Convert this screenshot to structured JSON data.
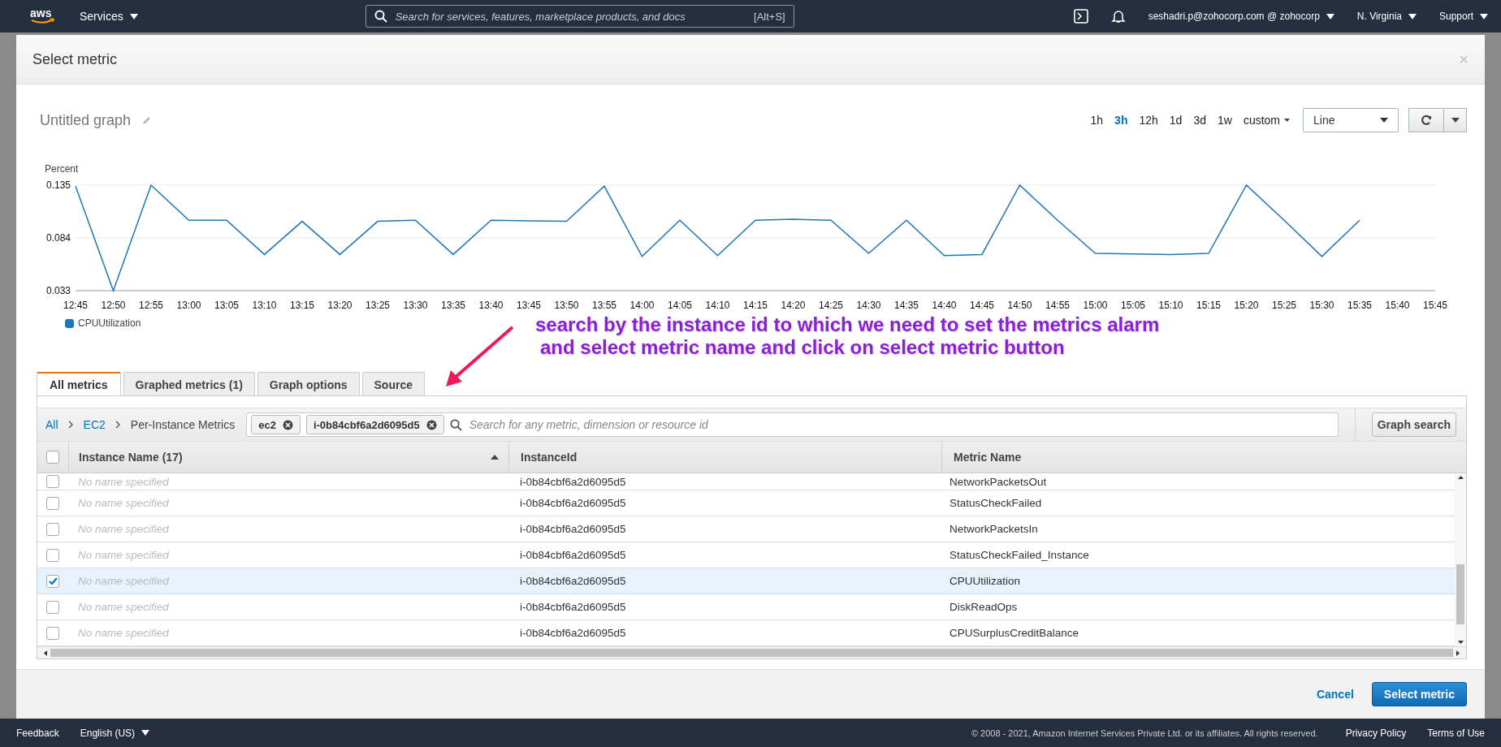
{
  "top_nav": {
    "logo": "aws",
    "services": "Services",
    "search": {
      "placeholder": "Search for services, features, marketplace products, and docs",
      "shortcut": "[Alt+S]"
    },
    "account": "seshadri.p@zohocorp.com @ zohocorp",
    "region": "N. Virginia",
    "support": "Support"
  },
  "dialog": {
    "title": "Select metric",
    "close": "×"
  },
  "graph": {
    "title": "Untitled graph",
    "ranges": [
      {
        "label": "1h",
        "selected": false
      },
      {
        "label": "3h",
        "selected": true
      },
      {
        "label": "12h",
        "selected": false
      },
      {
        "label": "1d",
        "selected": false
      },
      {
        "label": "3d",
        "selected": false
      },
      {
        "label": "1w",
        "selected": false
      },
      {
        "label": "custom",
        "selected": false
      }
    ],
    "view": "Line",
    "chart_data": {
      "type": "line",
      "ylabel": "Percent",
      "categories": [
        "12:45",
        "12:50",
        "12:55",
        "13:00",
        "13:05",
        "13:10",
        "13:15",
        "13:20",
        "13:25",
        "13:30",
        "13:35",
        "13:40",
        "13:45",
        "13:50",
        "13:55",
        "14:00",
        "14:05",
        "14:10",
        "14:15",
        "14:20",
        "14:25",
        "14:30",
        "14:35",
        "14:40",
        "14:45",
        "14:50",
        "14:55",
        "15:00",
        "15:05",
        "15:10",
        "15:15",
        "15:20",
        "15:25",
        "15:30",
        "15:35",
        "15:40",
        "15:45"
      ],
      "series": [
        {
          "name": "CPUUtilization",
          "color": "#1f77b4",
          "values": [
            0.134,
            0.033,
            0.135,
            0.101,
            0.101,
            0.068,
            0.1,
            0.068,
            0.1,
            0.101,
            0.068,
            0.101,
            0.1005,
            0.1,
            0.134,
            0.066,
            0.101,
            0.067,
            0.101,
            0.102,
            0.101,
            0.069,
            0.101,
            0.067,
            0.068,
            0.135,
            0.101,
            0.069,
            0.0685,
            0.068,
            0.069,
            0.135,
            0.101,
            0.066,
            0.101,
            null,
            null
          ]
        }
      ],
      "ylim": [
        0.033,
        0.135
      ],
      "yticks": [
        0.033,
        0.084,
        0.135
      ]
    }
  },
  "annotation": {
    "lines": [
      "search by the instance id to which we need to set the metrics alarm",
      "and select metric name and click on select metric button"
    ]
  },
  "tabs": [
    {
      "label": "All metrics",
      "selected": true
    },
    {
      "label": "Graphed metrics (1)",
      "selected": false
    },
    {
      "label": "Graph options",
      "selected": false
    },
    {
      "label": "Source",
      "selected": false
    }
  ],
  "breadcrumb": [
    {
      "label": "All",
      "kind": "link"
    },
    {
      "label": "EC2",
      "kind": "link"
    },
    {
      "label": "Per-Instance Metrics",
      "kind": "text"
    }
  ],
  "filters": [
    "ec2",
    "i-0b84cbf6a2d6095d5"
  ],
  "metric_search": {
    "placeholder": "Search for any metric, dimension or resource id"
  },
  "graph_search": "Graph search",
  "table": {
    "select_all_checked": false,
    "columns": [
      "Instance Name (17)",
      "InstanceId",
      "Metric Name"
    ],
    "rows": [
      {
        "name": "No name specified",
        "instance": "i-0b84cbf6a2d6095d5",
        "metric": "NetworkPacketsOut",
        "checked": false,
        "selected": false
      },
      {
        "name": "No name specified",
        "instance": "i-0b84cbf6a2d6095d5",
        "metric": "StatusCheckFailed",
        "checked": false,
        "selected": false
      },
      {
        "name": "No name specified",
        "instance": "i-0b84cbf6a2d6095d5",
        "metric": "NetworkPacketsIn",
        "checked": false,
        "selected": false
      },
      {
        "name": "No name specified",
        "instance": "i-0b84cbf6a2d6095d5",
        "metric": "StatusCheckFailed_Instance",
        "checked": false,
        "selected": false
      },
      {
        "name": "No name specified",
        "instance": "i-0b84cbf6a2d6095d5",
        "metric": "CPUUtilization",
        "checked": true,
        "selected": true
      },
      {
        "name": "No name specified",
        "instance": "i-0b84cbf6a2d6095d5",
        "metric": "DiskReadOps",
        "checked": false,
        "selected": false
      },
      {
        "name": "No name specified",
        "instance": "i-0b84cbf6a2d6095d5",
        "metric": "CPUSurplusCreditBalance",
        "checked": false,
        "selected": false
      }
    ]
  },
  "buttons": {
    "cancel": "Cancel",
    "confirm": "Select metric"
  },
  "footer": {
    "feedback": "Feedback",
    "language": "English (US)",
    "copyright": "© 2008 - 2021, Amazon Internet Services Private Ltd. or its affiliates. All rights reserved.",
    "privacy": "Privacy Policy",
    "terms": "Terms of Use"
  }
}
